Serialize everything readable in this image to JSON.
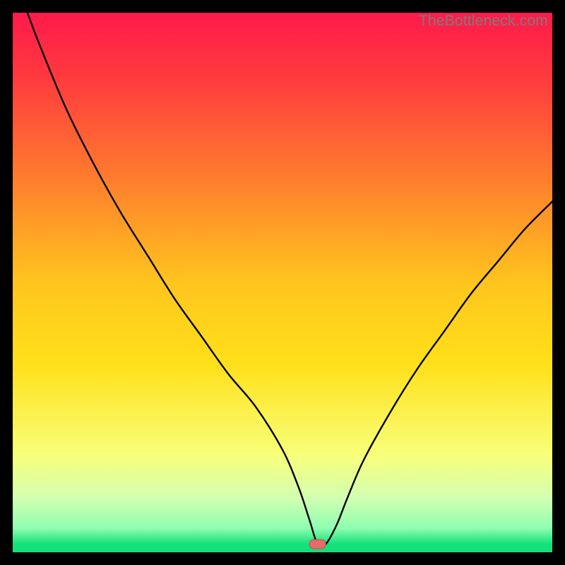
{
  "watermark": "TheBottleneck.com",
  "colors": {
    "top": "#ff1a4b",
    "mid1": "#ff7a2e",
    "mid2": "#ffe019",
    "mid3": "#f8ff7a",
    "mid4": "#d2ffb2",
    "bottom": "#14e07a",
    "curve": "#000000",
    "marker_fill": "#e86a6a",
    "marker_stroke": "#c24d4d",
    "frame": "#000000"
  },
  "chart_data": {
    "type": "line",
    "title": "",
    "xlabel": "",
    "ylabel": "",
    "xlim": [
      0,
      100
    ],
    "ylim": [
      0,
      100
    ],
    "series": [
      {
        "name": "bottleneck-curve",
        "x": [
          0,
          2,
          5,
          10,
          15,
          20,
          25,
          30,
          35,
          40,
          45,
          50,
          53,
          55,
          56.5,
          58,
          60,
          62,
          65,
          70,
          75,
          80,
          85,
          90,
          95,
          100
        ],
        "values": [
          108,
          102,
          94,
          82,
          72,
          63,
          55,
          47,
          40,
          33,
          27,
          19,
          12,
          6,
          1.5,
          1.5,
          5,
          10,
          17,
          26,
          34,
          41,
          48,
          54,
          60,
          65
        ]
      }
    ],
    "marker": {
      "x_start": 55,
      "x_end": 58,
      "y": 1.5,
      "shape": "rounded-bar"
    },
    "gradient_stops": [
      {
        "offset": 0.0,
        "color": "#ff1a4b"
      },
      {
        "offset": 0.12,
        "color": "#ff3a3e"
      },
      {
        "offset": 0.3,
        "color": "#ff7a2e"
      },
      {
        "offset": 0.5,
        "color": "#ffc51e"
      },
      {
        "offset": 0.65,
        "color": "#ffe019"
      },
      {
        "offset": 0.82,
        "color": "#f8ff7a"
      },
      {
        "offset": 0.9,
        "color": "#d2ffb2"
      },
      {
        "offset": 0.955,
        "color": "#8fffb0"
      },
      {
        "offset": 0.985,
        "color": "#14e07a"
      },
      {
        "offset": 1.0,
        "color": "#14e07a"
      }
    ]
  }
}
